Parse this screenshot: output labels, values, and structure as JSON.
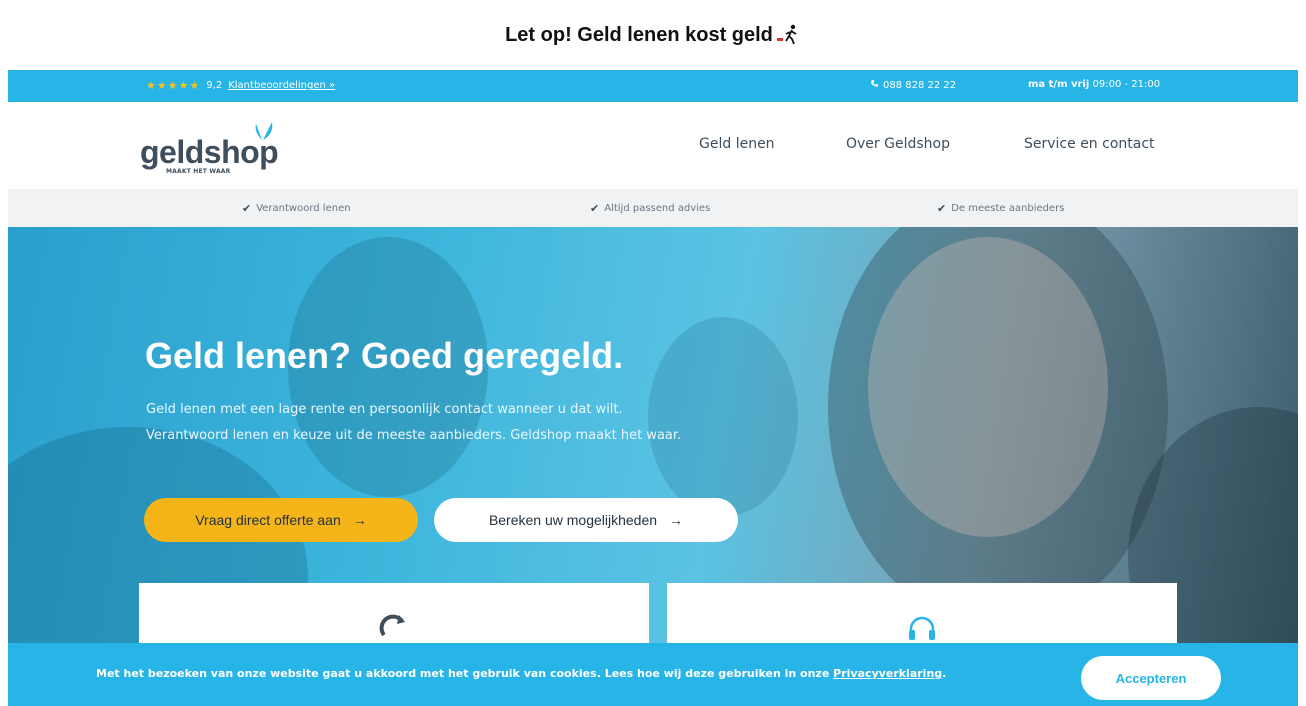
{
  "warning": {
    "text": "Let op! Geld lenen kost geld"
  },
  "topbar": {
    "stars": "★★★★★",
    "rating": "9,2",
    "reviews_link": "Klantbeoordelingen »",
    "phone": "088 828 22 22",
    "hours_label": "ma t/m vrij",
    "hours_value": "09:00 - 21:00"
  },
  "logo": {
    "name": "geldshop",
    "tagline": "MAAKT HET WAAR"
  },
  "nav": [
    "Geld lenen",
    "Over Geldshop",
    "Service en contact"
  ],
  "usps": [
    "Verantwoord lenen",
    "Altijd passend advies",
    "De meeste aanbieders"
  ],
  "hero": {
    "title": "Geld lenen? Goed geregeld.",
    "line1": "Geld lenen met een lage rente en persoonlijk contact wanneer u dat wilt.",
    "line2": "Verantwoord lenen en keuze uit de meeste aanbieders. Geldshop maakt het waar.",
    "cta_primary": "Vraag direct offerte aan",
    "cta_secondary": "Bereken uw mogelijkheden",
    "arrow": "→"
  },
  "cookie": {
    "text": "Met het bezoeken van onze website gaat u akkoord met het gebruik van cookies. Lees hoe wij deze gebruiken in onze ",
    "link": "Privacyverklaring",
    "period": ".",
    "accept": "Accepteren"
  },
  "colors": {
    "brand_blue": "#27b4e6",
    "cta_yellow": "#f5b418",
    "text_dark": "#3e4e5c"
  },
  "icons": [
    "walking-person-icon",
    "star-icon",
    "phone-icon",
    "butterfly-icon",
    "check-icon",
    "arrow-right-icon",
    "refresh-icon",
    "headset-icon"
  ]
}
